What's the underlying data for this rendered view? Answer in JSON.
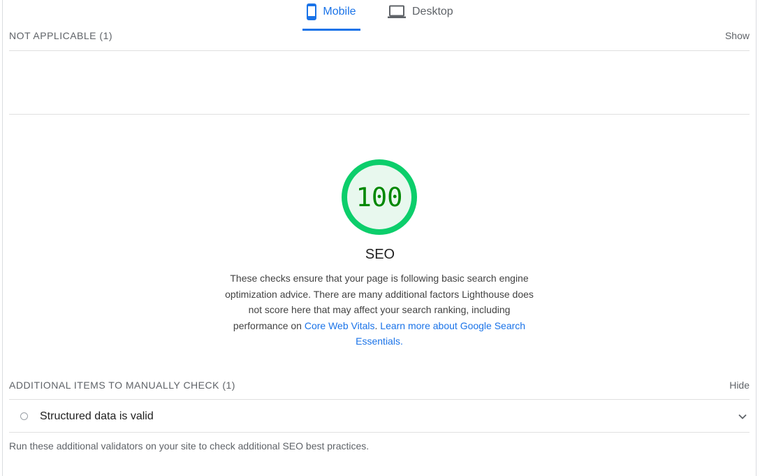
{
  "tabs": [
    {
      "label": "Mobile",
      "icon": "smartphone-icon",
      "active": true
    },
    {
      "label": "Desktop",
      "icon": "laptop-icon",
      "active": false
    }
  ],
  "not_applicable": {
    "title": "NOT APPLICABLE (1)",
    "toggle": "Show"
  },
  "category": {
    "score": "100",
    "title": "SEO",
    "description_prefix": "These checks ensure that your page is following basic search engine optimization advice. There are many additional factors Lighthouse does not score here that may affect your search ranking, including performance on ",
    "link_core_web_vitals": "Core Web Vitals",
    "link_learn_more": "Learn more about Google Search Essentials",
    "gauge_color": "#0cce6b",
    "gauge_fill": "#e8f8ee",
    "score_color": "#008800"
  },
  "manual_check": {
    "title": "ADDITIONAL ITEMS TO MANUALLY CHECK (1)",
    "toggle": "Hide",
    "items": [
      {
        "label": "Structured data is valid"
      }
    ],
    "footnote": "Run these additional validators on your site to check additional SEO best practices."
  },
  "colors": {
    "accent": "#1a73e8",
    "pass": "#0cce6b"
  }
}
